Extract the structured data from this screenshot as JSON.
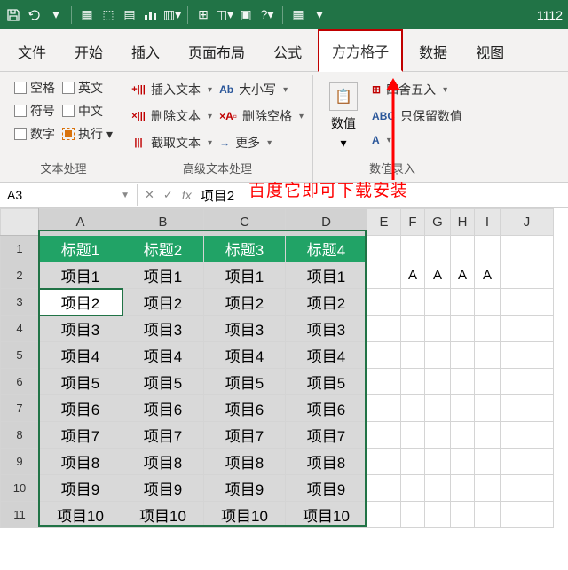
{
  "titlebar": {
    "number": "1112"
  },
  "tabs": [
    "文件",
    "开始",
    "插入",
    "页面布局",
    "公式",
    "方方格子",
    "数据",
    "视图"
  ],
  "active_tab_index": 5,
  "groups": {
    "text": {
      "title": "文本处理",
      "checks": [
        "空格",
        "英文",
        "符号",
        "中文",
        "数字",
        "执行"
      ]
    },
    "adv": {
      "title": "高级文本处理",
      "cmds": [
        "插入文本",
        "删除文本",
        "截取文本",
        "大小写",
        "删除空格",
        "更多"
      ]
    },
    "numrec": {
      "title": "数值录入",
      "btn": "数值",
      "cmds": [
        "四舍五入",
        "只保留数值"
      ]
    }
  },
  "annotation": "百度它即可下载安装",
  "namebox": "A3",
  "formula_value": "项目2",
  "chart_data": {
    "type": "table",
    "col_headers": [
      "A",
      "B",
      "C",
      "D",
      "E",
      "F",
      "G",
      "H",
      "I",
      "J"
    ],
    "row_headers": [
      "1",
      "2",
      "3",
      "4",
      "5",
      "6",
      "7",
      "8",
      "9",
      "10",
      "11"
    ],
    "header_row": [
      "标题1",
      "标题2",
      "标题3",
      "标题4"
    ],
    "data_rows": [
      [
        "项目1",
        "项目1",
        "项目1",
        "项目1"
      ],
      [
        "项目2",
        "项目2",
        "项目2",
        "项目2"
      ],
      [
        "项目3",
        "项目3",
        "项目3",
        "项目3"
      ],
      [
        "项目4",
        "项目4",
        "项目4",
        "项目4"
      ],
      [
        "项目5",
        "项目5",
        "项目5",
        "项目5"
      ],
      [
        "项目6",
        "项目6",
        "项目6",
        "项目6"
      ],
      [
        "项目7",
        "项目7",
        "项目7",
        "项目7"
      ],
      [
        "项目8",
        "项目8",
        "项目8",
        "项目8"
      ],
      [
        "项目9",
        "项目9",
        "项目9",
        "项目9"
      ],
      [
        "项目10",
        "项目10",
        "项目10",
        "项目10"
      ]
    ],
    "extra": {
      "row2": {
        "F": "A",
        "G": "A",
        "H": "A",
        "I": "A"
      }
    },
    "active_cell": "A3",
    "selection": "A1:D11"
  }
}
